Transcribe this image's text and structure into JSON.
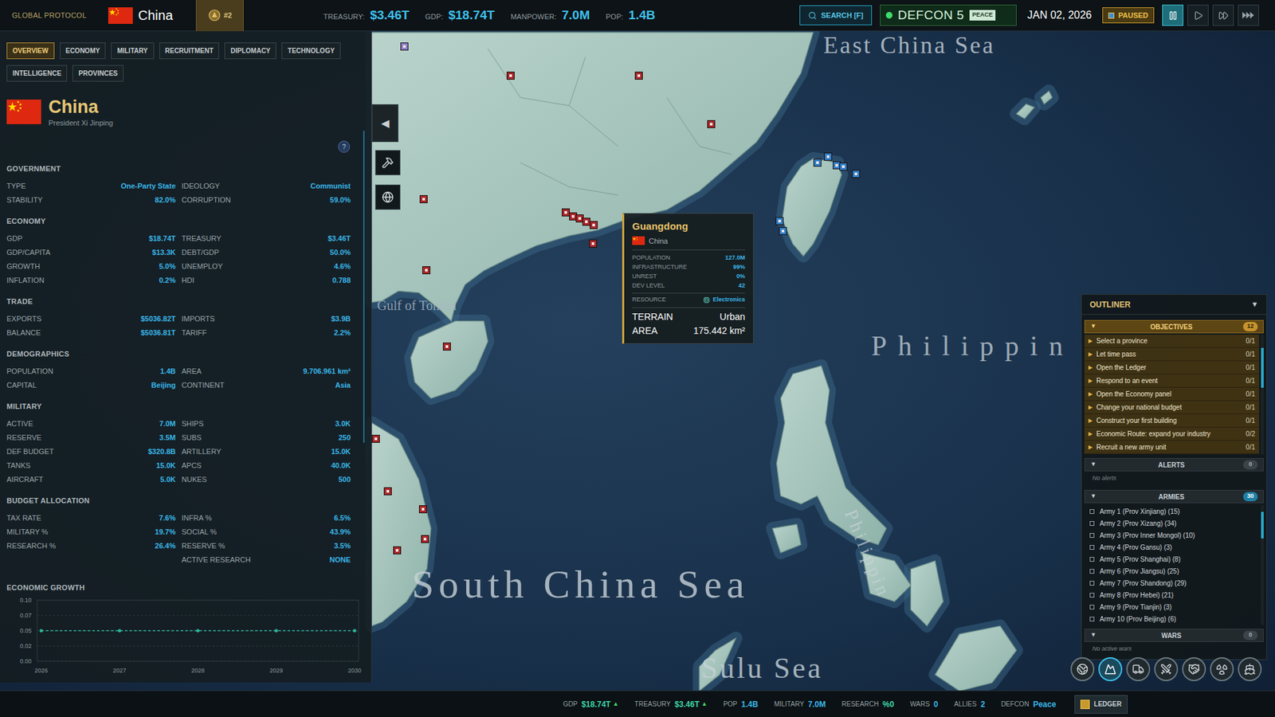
{
  "top_bar": {
    "brand": "GLOBAL PROTOCOL",
    "country": "China",
    "rank": "#2",
    "stats": [
      {
        "label": "TREASURY:",
        "value": "$3.46T"
      },
      {
        "label": "GDP:",
        "value": "$18.74T"
      },
      {
        "label": "MANPOWER:",
        "value": "7.0M"
      },
      {
        "label": "POP:",
        "value": "1.4B"
      }
    ],
    "search": "SEARCH [F]",
    "defcon": {
      "label": "DEFCON 5",
      "status": "PEACE"
    },
    "date": "JAN 02, 2026",
    "paused": "PAUSED",
    "speed_buttons": [
      {
        "selected": true
      },
      {
        "selected": false
      },
      {
        "selected": false
      },
      {
        "selected": false
      }
    ]
  },
  "panel": {
    "tabs": [
      {
        "label": "OVERVIEW",
        "selected": true
      },
      {
        "label": "ECONOMY",
        "selected": false
      },
      {
        "label": "MILITARY",
        "selected": false
      },
      {
        "label": "RECRUITMENT",
        "selected": false
      },
      {
        "label": "DIPLOMACY",
        "selected": false
      },
      {
        "label": "TECHNOLOGY",
        "selected": false
      },
      {
        "label": "INTELLIGENCE",
        "selected": false
      },
      {
        "label": "PROVINCES",
        "selected": false
      }
    ],
    "country": "China",
    "leader": "President Xi Jinping",
    "help": "?",
    "collapse": "◀",
    "sections": [
      {
        "title": "GOVERNMENT",
        "rows": [
          {
            "left": {
              "label": "TYPE",
              "value": "One-Party State"
            },
            "right": {
              "label": "IDEOLOGY",
              "value": "Communist"
            }
          },
          {
            "left": {
              "label": "STABILITY",
              "value": "82.0%"
            },
            "right": {
              "label": "CORRUPTION",
              "value": "59.0%"
            }
          }
        ]
      },
      {
        "title": "ECONOMY",
        "rows": [
          {
            "left": {
              "label": "GDP",
              "value": "$18.74T"
            },
            "right": {
              "label": "TREASURY",
              "value": "$3.46T"
            }
          },
          {
            "left": {
              "label": "GDP/CAPITA",
              "value": "$13.3K"
            },
            "right": {
              "label": "DEBT/GDP",
              "value": "50.0%"
            }
          },
          {
            "left": {
              "label": "GROWTH",
              "value": "5.0%"
            },
            "right": {
              "label": "UNEMPLOY",
              "value": "4.6%"
            }
          },
          {
            "left": {
              "label": "INFLATION",
              "value": "0.2%"
            },
            "right": {
              "label": "HDI",
              "value": "0.788"
            }
          }
        ]
      },
      {
        "title": "TRADE",
        "rows": [
          {
            "left": {
              "label": "EXPORTS",
              "value": "$5036.82T"
            },
            "right": {
              "label": "IMPORTS",
              "value": "$3.9B"
            }
          },
          {
            "left": {
              "label": "BALANCE",
              "value": "$5036.81T"
            },
            "right": {
              "label": "TARIFF",
              "value": "2.2%"
            }
          }
        ]
      },
      {
        "title": "DEMOGRAPHICS",
        "rows": [
          {
            "left": {
              "label": "POPULATION",
              "value": "1.4B"
            },
            "right": {
              "label": "AREA",
              "value": "9.706.961 km²"
            }
          },
          {
            "left": {
              "label": "CAPITAL",
              "value": "Beijing"
            },
            "right": {
              "label": "CONTINENT",
              "value": "Asia"
            }
          }
        ]
      },
      {
        "title": "MILITARY",
        "rows": [
          {
            "left": {
              "label": "ACTIVE",
              "value": "7.0M"
            },
            "right": {
              "label": "SHIPS",
              "value": "3.0K"
            }
          },
          {
            "left": {
              "label": "RESERVE",
              "value": "3.5M"
            },
            "right": {
              "label": "SUBS",
              "value": "250"
            }
          },
          {
            "left": {
              "label": "DEF BUDGET",
              "value": "$320.8B"
            },
            "right": {
              "label": "ARTILLERY",
              "value": "15.0K"
            }
          },
          {
            "left": {
              "label": "TANKS",
              "value": "15.0K"
            },
            "right": {
              "label": "APCS",
              "value": "40.0K"
            }
          },
          {
            "left": {
              "label": "AIRCRAFT",
              "value": "5.0K"
            },
            "right": {
              "label": "NUKES",
              "value": "500"
            }
          }
        ]
      },
      {
        "title": "BUDGET ALLOCATION",
        "rows": [
          {
            "left": {
              "label": "TAX RATE",
              "value": "7.6%"
            },
            "right": {
              "label": "INFRA %",
              "value": "6.5%"
            }
          },
          {
            "left": {
              "label": "MILITARY %",
              "value": "19.7%"
            },
            "right": {
              "label": "SOCIAL %",
              "value": "43.9%"
            }
          },
          {
            "left": {
              "label": "RESEARCH %",
              "value": "26.4%"
            },
            "right": {
              "label": "RESERVE %",
              "value": "3.5%"
            }
          },
          {
            "right": {
              "label": "ACTIVE RESEARCH",
              "value": "NONE"
            }
          }
        ]
      }
    ],
    "chart": {
      "title": "ECONOMIC GROWTH",
      "y_ticks": [
        "0.10",
        "0.07",
        "0.05",
        "0.02",
        "0.00"
      ],
      "x_ticks": [
        "2026",
        "2027",
        "2028",
        "2029",
        "2030"
      ],
      "series": [
        {
          "values": [
            0.05,
            0.05,
            0.05,
            0.05,
            0.05
          ]
        }
      ]
    }
  },
  "tooltip": {
    "title": "Guangdong",
    "country": "China",
    "rows": [
      {
        "label": "POPULATION",
        "value": "127.0M"
      },
      {
        "label": "INFRASTRUCTURE",
        "value": "99%"
      },
      {
        "label": "UNREST",
        "value": "0%"
      },
      {
        "label": "DEV LEVEL",
        "value": "42"
      }
    ],
    "resource": {
      "label": "RESOURCE",
      "value": "Electronics"
    },
    "details": [
      {
        "label": "TERRAIN",
        "value": "Urban"
      },
      {
        "label": "AREA",
        "value": "175.442 km²"
      }
    ]
  },
  "outliner": {
    "title": "OUTLINER",
    "toggle": "▼",
    "sections": [
      {
        "title": "OBJECTIVES",
        "count": "12",
        "toggle": "▼",
        "expanded": true,
        "kind": "objectives",
        "bullet": "▶",
        "items": [
          {
            "label": "Select a province",
            "progress": "0/1"
          },
          {
            "label": "Let time pass",
            "progress": "0/1"
          },
          {
            "label": "Open the Ledger",
            "progress": "0/1"
          },
          {
            "label": "Respond to an event",
            "progress": "0/1"
          },
          {
            "label": "Open the Economy panel",
            "progress": "0/1"
          },
          {
            "label": "Change your national budget",
            "progress": "0/1"
          },
          {
            "label": "Construct your first building",
            "progress": "0/1"
          },
          {
            "label": "Economic Route: expand your industry",
            "progress": "0/2"
          },
          {
            "label": "Recruit a new army unit",
            "progress": "0/1"
          }
        ]
      },
      {
        "title": "ALERTS",
        "count": "0",
        "toggle": "▼",
        "expanded": true,
        "kind": "empty",
        "empty": "No alerts"
      },
      {
        "title": "ARMIES",
        "count": "30",
        "toggle": "▼",
        "expanded": true,
        "kind": "armies",
        "items": [
          {
            "label": "Army 1 (Prov Xinjiang) (15)",
            "checked": false
          },
          {
            "label": "Army 2 (Prov Xizang) (34)",
            "checked": false
          },
          {
            "label": "Army 3 (Prov Inner Mongol) (10)",
            "checked": false
          },
          {
            "label": "Army 4 (Prov Gansu) (3)",
            "checked": false
          },
          {
            "label": "Army 5 (Prov Shanghai) (8)",
            "checked": false
          },
          {
            "label": "Army 6 (Prov Jiangsu) (25)",
            "checked": false
          },
          {
            "label": "Army 7 (Prov Shandong) (29)",
            "checked": false
          },
          {
            "label": "Army 8 (Prov Hebei) (21)",
            "checked": false
          },
          {
            "label": "Army 9 (Prov Tianjin) (3)",
            "checked": false
          },
          {
            "label": "Army 10 (Prov Beijing) (6)",
            "checked": false
          }
        ]
      },
      {
        "title": "WARS",
        "count": "0",
        "toggle": "▼",
        "expanded": true,
        "kind": "empty",
        "empty": "No active wars"
      }
    ]
  },
  "map_modes": [
    {
      "selected": false
    },
    {
      "selected": true
    },
    {
      "selected": false
    },
    {
      "selected": false
    },
    {
      "selected": false
    },
    {
      "selected": false
    },
    {
      "selected": false
    }
  ],
  "status_bar": {
    "items": [
      {
        "label": "GDP",
        "value": "$18.74T",
        "trend": "▲",
        "color": "#3fd6a8"
      },
      {
        "label": "TREASURY",
        "value": "$3.46T",
        "trend": "▲",
        "color": "#3fd6a8"
      },
      {
        "label": "POP",
        "value": "1.4B",
        "color": "#3ab7ea"
      },
      {
        "label": "MILITARY",
        "value": "7.0M",
        "color": "#3ab7ea"
      },
      {
        "label": "RESEARCH",
        "value": "%0",
        "color": "#3fd6a8"
      },
      {
        "label": "WARS",
        "value": "0",
        "color": "#3ab7ea"
      },
      {
        "label": "ALLIES",
        "value": "2",
        "color": "#3ab7ea"
      },
      {
        "label": "DEFCON",
        "value": "Peace",
        "color": "#3ab7ea"
      }
    ],
    "ledger": "LEDGER"
  },
  "map_labels": [
    {
      "text": "East China Sea"
    },
    {
      "text": "Philippin"
    },
    {
      "text": "Gulf of Tonkin"
    },
    {
      "text": "South China Sea"
    },
    {
      "text": "Sulu Sea"
    },
    {
      "text": "Philippin"
    }
  ],
  "map_markers": [
    {
      "color": "#a8282a"
    },
    {
      "color": "#a8282a"
    },
    {
      "color": "#a8282a"
    },
    {
      "color": "#a8282a"
    },
    {
      "color": "#a8282a"
    },
    {
      "color": "#a8282a"
    },
    {
      "color": "#a8282a"
    },
    {
      "color": "#a8282a"
    },
    {
      "color": "#a8282a"
    },
    {
      "color": "#a8282a"
    },
    {
      "color": "#a8282a"
    },
    {
      "color": "#a8282a"
    },
    {
      "color": "#a8282a"
    },
    {
      "color": "#a8282a"
    },
    {
      "color": "#a8282a"
    },
    {
      "color": "#a8282a"
    },
    {
      "color": "#a8282a"
    },
    {
      "color": "#2f7fc8"
    },
    {
      "color": "#2f7fc8"
    },
    {
      "color": "#2f7fc8"
    },
    {
      "color": "#2f7fc8"
    },
    {
      "color": "#2f7fc8"
    },
    {
      "color": "#2f7fc8"
    },
    {
      "color": "#2f7fc8"
    },
    {
      "color": "#8a7fc8"
    }
  ]
}
